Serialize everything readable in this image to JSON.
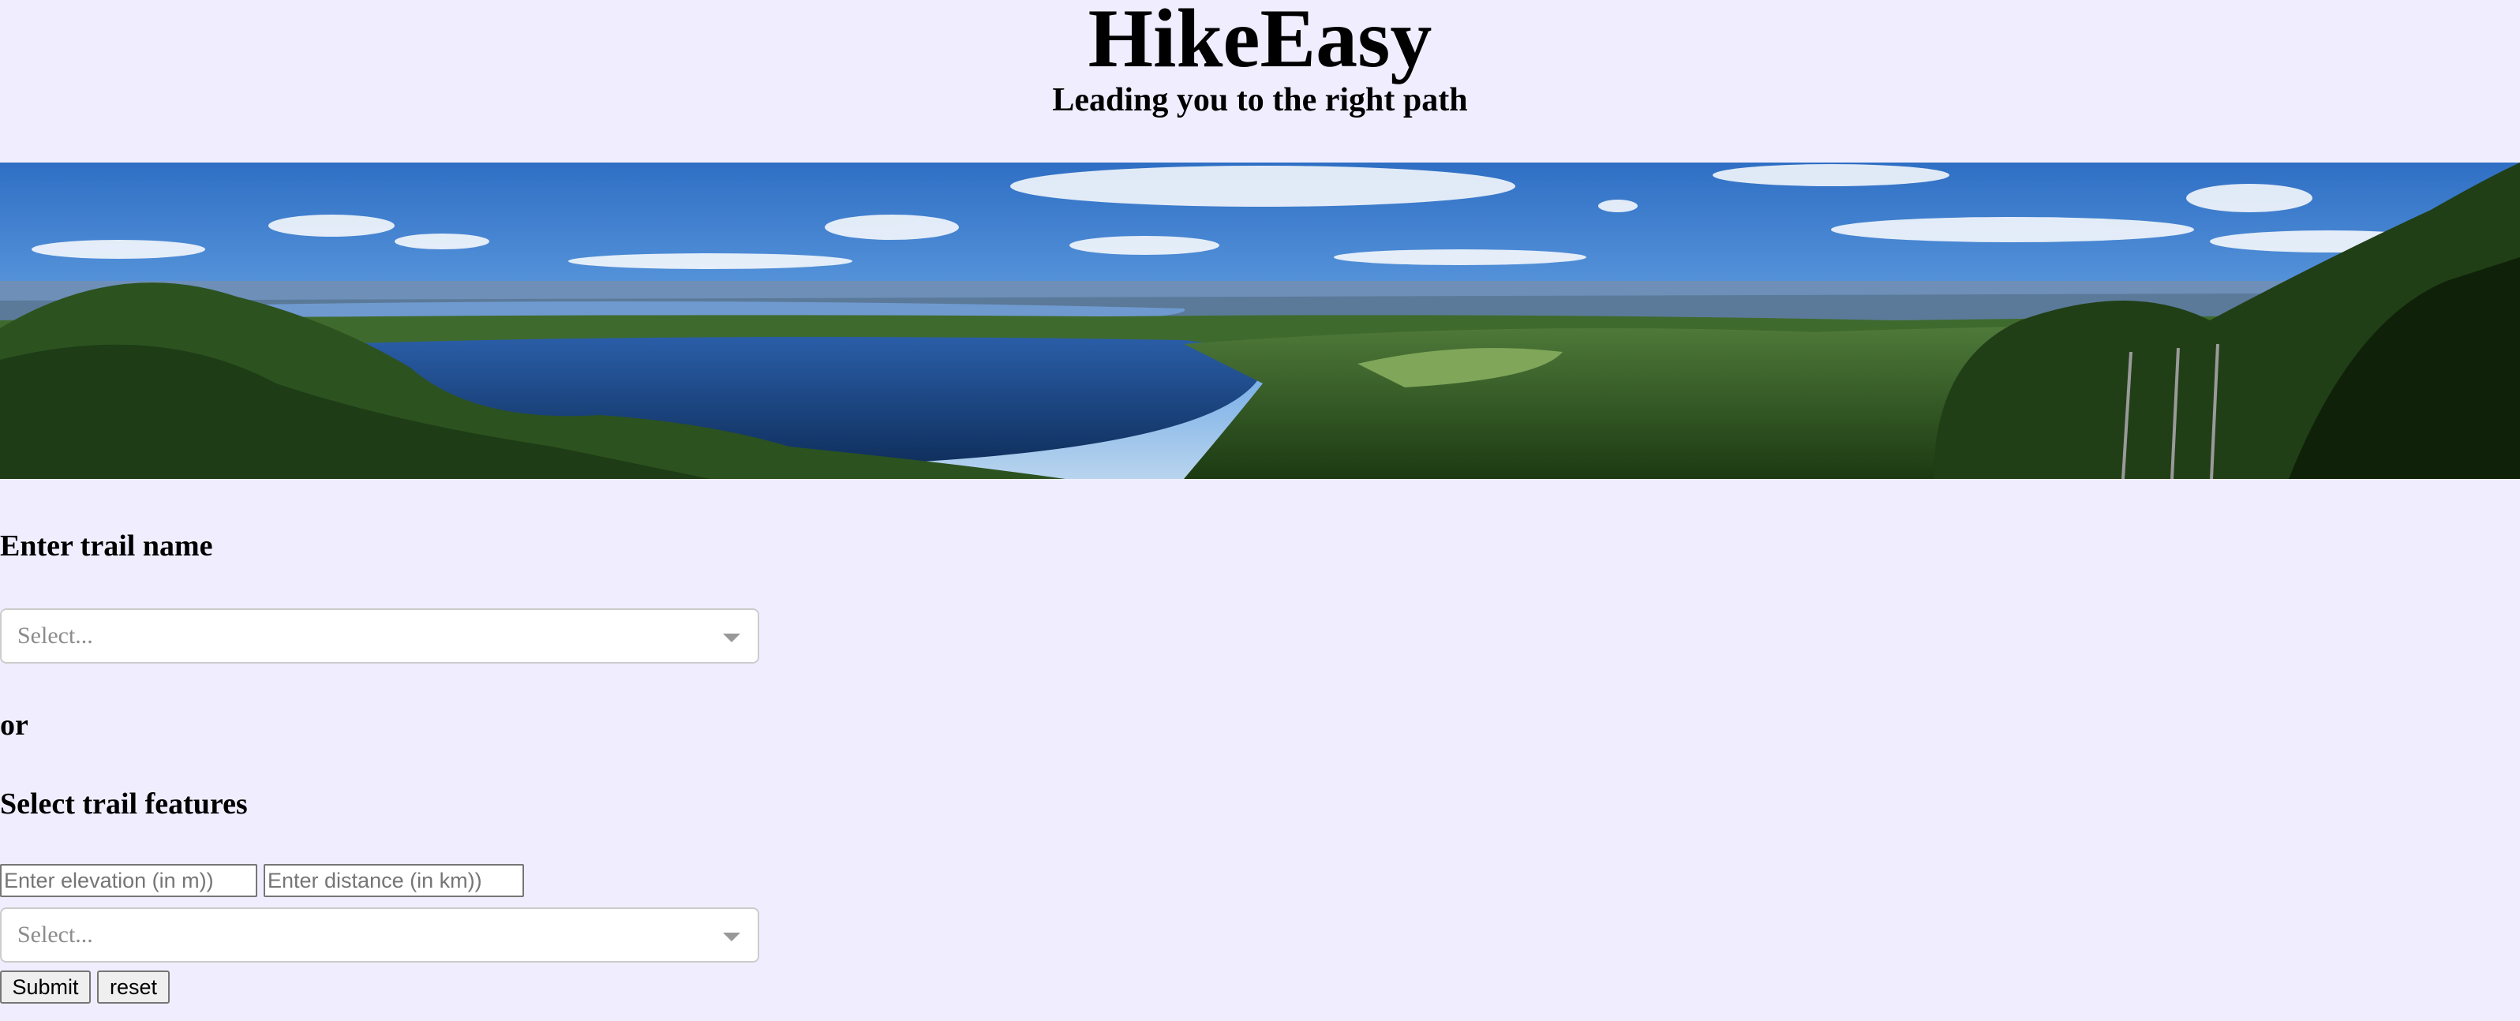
{
  "header": {
    "title": "HikeEasy",
    "tagline": "Leading you to the right path"
  },
  "trail_name": {
    "heading": "Enter trail name",
    "select": {
      "placeholder": "Select..."
    }
  },
  "separator_text": "or",
  "features": {
    "heading": "Select trail features",
    "elevation_placeholder": "Enter elevation (in m))",
    "distance_placeholder": "Enter distance (in km))",
    "select": {
      "placeholder": "Select..."
    }
  },
  "buttons": {
    "submit_label": "Submit",
    "reset_label": "reset"
  },
  "colors": {
    "page_background": "#f0eefe",
    "sky": "#4a8ed8",
    "lake": "#1e4a8c",
    "forest": "#2f5a1e"
  }
}
